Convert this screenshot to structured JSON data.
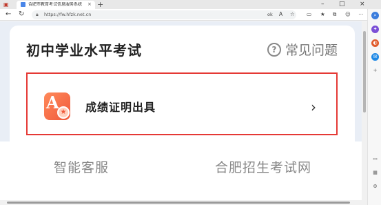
{
  "browser": {
    "tab_title": "合肥市教育考试信息服务系统",
    "tab_close": "×",
    "new_tab": "+",
    "url": "https://fw.hfzk.net.cn",
    "window_controls": {
      "minimize": "–",
      "maximize": "□",
      "close": "×"
    },
    "nav": {
      "back": "←",
      "reload": "↻"
    },
    "toolbar_icons": [
      "ok-icon",
      "read-aloud-icon",
      "favorite-icon",
      "split-screen-icon",
      "favorites-icon",
      "collections-icon",
      "profile-icon",
      "more-icon"
    ]
  },
  "page": {
    "heading": "初中学业水平考试",
    "faq": {
      "icon": "?",
      "label": "常见问题"
    },
    "certificate": {
      "icon_letter": "A",
      "label": "成绩证明出具",
      "chevron": "›"
    },
    "bottom_links": [
      "智能客服",
      "合肥招生考试网"
    ]
  },
  "colors": {
    "highlight_border": "#e53935",
    "icon_gradient_start": "#ff8a5b",
    "icon_gradient_end": "#f0593a"
  }
}
